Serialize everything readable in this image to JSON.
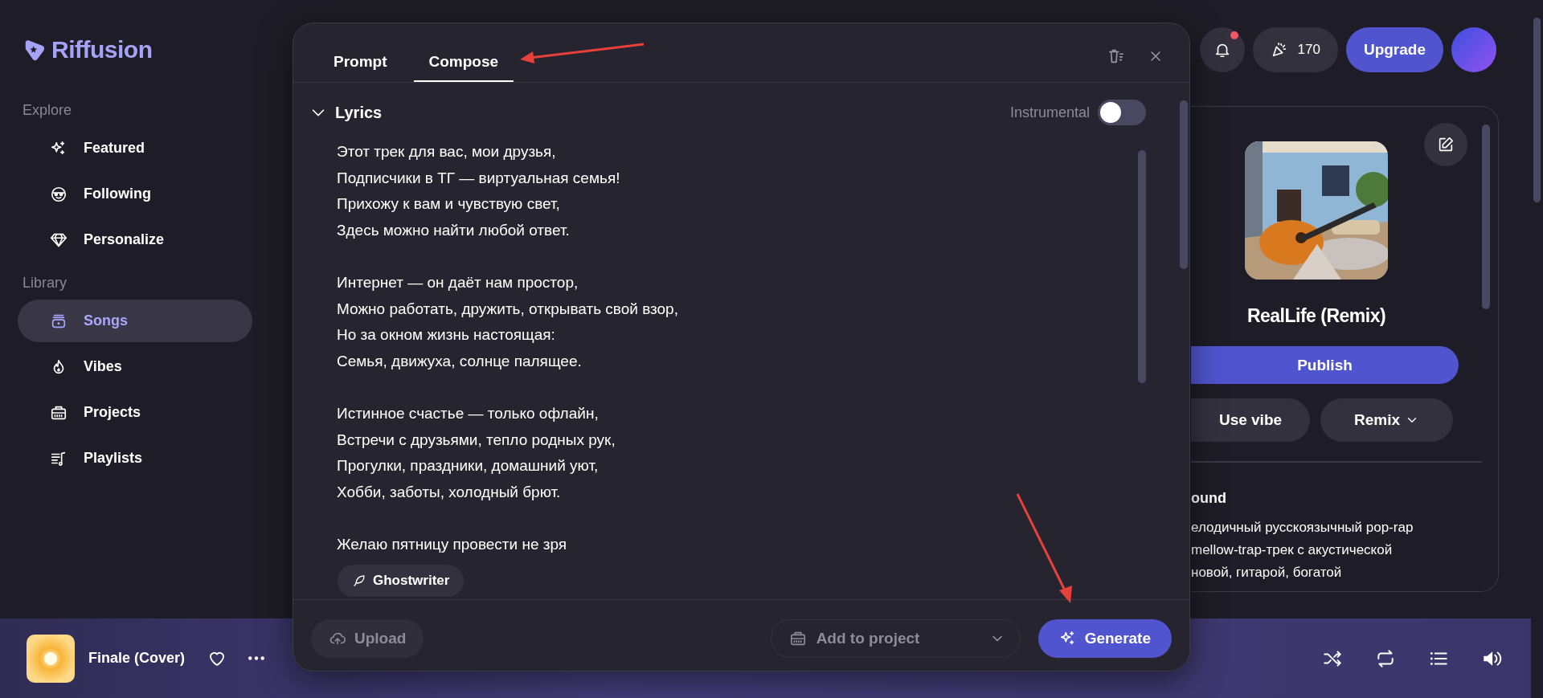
{
  "sidebar": {
    "logo": "Riffusion",
    "sections": [
      {
        "title": "Explore",
        "items": [
          {
            "label": "Featured",
            "selected": false
          },
          {
            "label": "Following",
            "selected": false
          },
          {
            "label": "Personalize",
            "selected": false
          }
        ]
      },
      {
        "title": "Library",
        "items": [
          {
            "label": "Songs",
            "selected": true
          },
          {
            "label": "Vibes",
            "selected": false
          },
          {
            "label": "Projects",
            "selected": false
          },
          {
            "label": "Playlists",
            "selected": false
          }
        ]
      }
    ]
  },
  "topbar": {
    "notification_dot": true,
    "credits": "170",
    "upgrade": "Upgrade"
  },
  "song_panel": {
    "kind": "picture",
    "title": "RealLife (Remix)",
    "publish": "Publish",
    "use_vibe": "Use vibe",
    "remix": "Remix",
    "section_heading": "ound",
    "description_lines": [
      "елодичный русскоязычный pop-rap",
      "mellow-trap-трек с акустической",
      "новой, гитарой, богатой"
    ]
  },
  "composer": {
    "tabs": [
      {
        "label": "Prompt",
        "selected": false
      },
      {
        "label": "Compose",
        "selected": true
      }
    ],
    "lyrics": {
      "heading": "Lyrics",
      "expanded": true,
      "instrumental_label": "Instrumental",
      "instrumental": false,
      "stanzas": [
        [
          "Этот трек для вас, мои друзья,",
          "Подписчики в ТГ — виртуальная семья!",
          "Прихожу к вам и чувствую свет,",
          "Здесь можно найти любой ответ."
        ],
        [
          "Интернет — он даёт нам простор,",
          "Можно работать, дружить, открывать свой взор,",
          "Но за окном жизнь настоящая:",
          "Семья, движуха, солнце палящее."
        ],
        [
          "Истинное счастье — только офлайн,",
          "Встречи с друзьями, тепло родных рук,",
          "Прогулки, праздники, домашний уют,",
          "Хобби, заботы, холодный брют."
        ],
        [
          "Желаю пятницу провести не зря"
        ]
      ]
    },
    "ghostwriter": "Ghostwriter",
    "upload": {
      "label": "Upload",
      "disabled": true
    },
    "project_placeholder": "Add to project",
    "generate": "Generate"
  },
  "player": {
    "title": "Finale (Cover)",
    "liked": false
  }
}
